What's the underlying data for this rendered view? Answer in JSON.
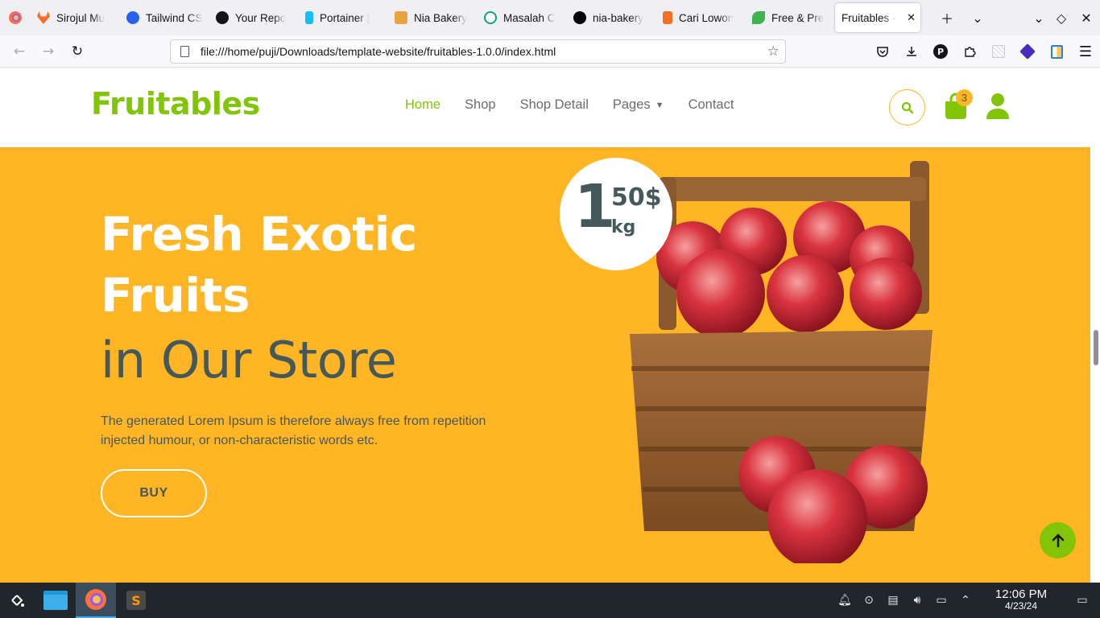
{
  "browser": {
    "tabs": [
      {
        "label": "Sirojul Mu",
        "color": "#fc6d26"
      },
      {
        "label": "Tailwind CS",
        "color": "#2563eb"
      },
      {
        "label": "Your Repo",
        "color": "#15141a"
      },
      {
        "label": "Portainer |",
        "color": "#13bef9"
      },
      {
        "label": "Nia Bakery",
        "color": "#e8a33d"
      },
      {
        "label": "Masalah C",
        "color": "#10a37f"
      },
      {
        "label": "nia-bakery",
        "color": "#000000"
      },
      {
        "label": "Cari Lowon",
        "color": "#f36f21"
      },
      {
        "label": "Free & Pre",
        "color": "#3fb34f"
      },
      {
        "label": "Fruitables -",
        "color": "#81c408",
        "active": true
      }
    ],
    "url": "file:///home/puji/Downloads/template-website/fruitables-1.0.0/index.html"
  },
  "site": {
    "brand": "Fruitables",
    "menu": {
      "home": "Home",
      "shop": "Shop",
      "shop_detail": "Shop Detail",
      "pages": "Pages",
      "contact": "Contact"
    },
    "cart_count": "3",
    "colors": {
      "primary": "#81c408",
      "secondary": "#ffb524",
      "dark": "#45595b"
    }
  },
  "hero": {
    "title_line1": "Fresh Exotic",
    "title_line2": "Fruits",
    "subtitle": "in Our Store",
    "description": "The generated Lorem Ipsum is therefore always free from repetition injected humour, or non-characteristic words etc.",
    "button": "BUY",
    "price": {
      "main": "1",
      "cents": "50$",
      "unit": "kg"
    }
  },
  "taskbar": {
    "time": "12:06 PM",
    "date": "4/23/24"
  }
}
